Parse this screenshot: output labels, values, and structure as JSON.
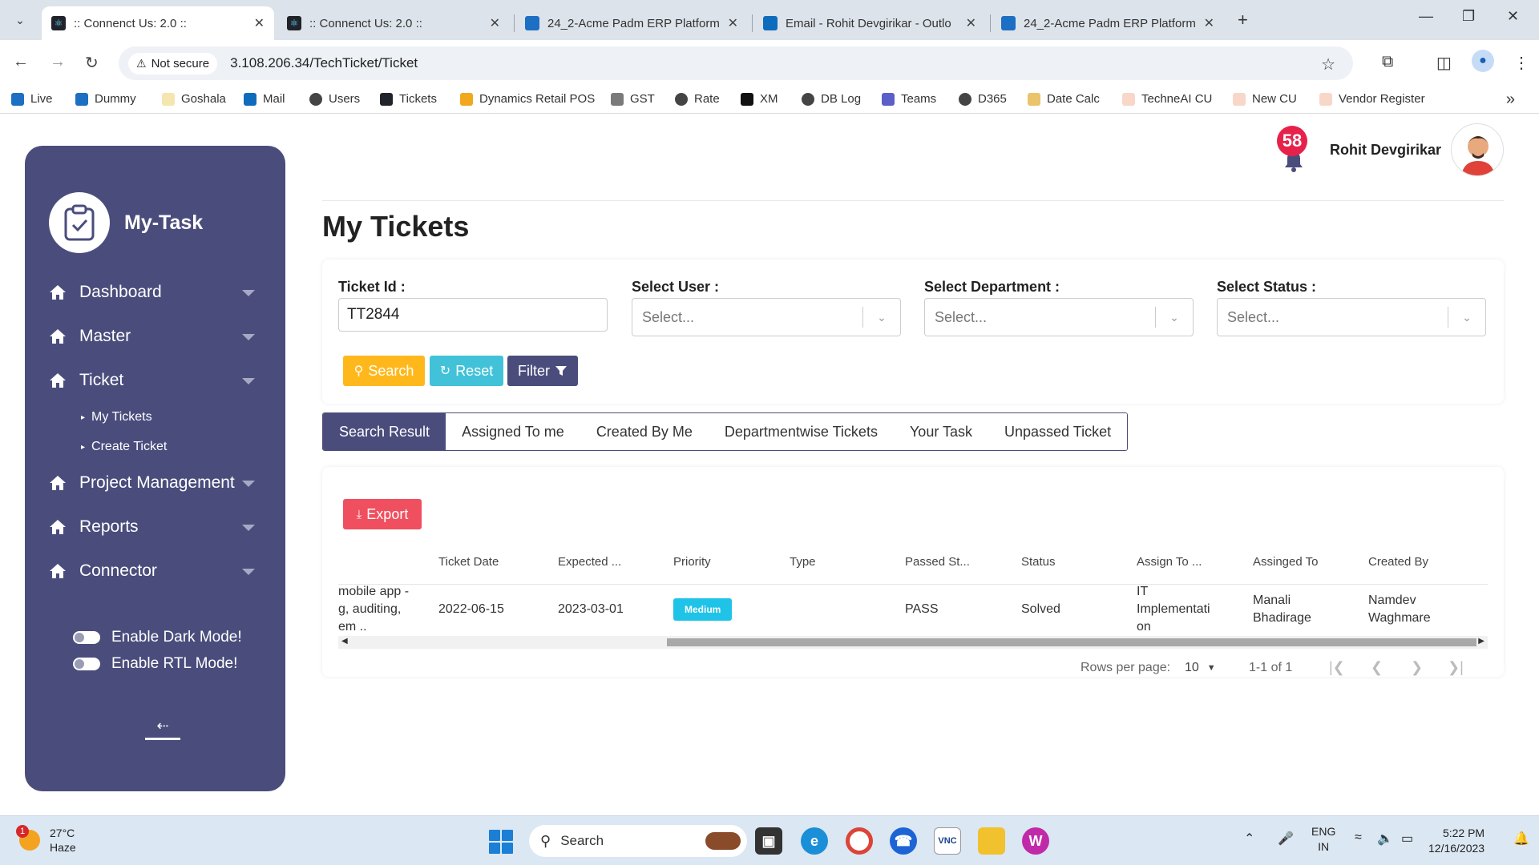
{
  "browser": {
    "tabs": [
      {
        "title": ":: Connenct Us: 2.0 ::",
        "active": true
      },
      {
        "title": ":: Connenct Us: 2.0 ::",
        "active": false
      },
      {
        "title": "24_2-Acme Padm ERP Platform",
        "active": false
      },
      {
        "title": "Email - Rohit Devgirikar - Outlo",
        "active": false
      },
      {
        "title": "24_2-Acme Padm ERP Platform",
        "active": false
      }
    ],
    "security_label": "Not secure",
    "url": "3.108.206.34/TechTicket/Ticket",
    "bookmarks": [
      "Live",
      "Dummy",
      "Goshala",
      "Mail",
      "Users",
      "Tickets",
      "Dynamics Retail POS",
      "GST",
      "Rate",
      "XM",
      "DB Log",
      "Teams",
      "D365",
      "Date Calc",
      "TechneAI CU",
      "New CU",
      "Vendor Register"
    ]
  },
  "sidebar": {
    "brand": "My-Task",
    "items": [
      {
        "label": "Dashboard"
      },
      {
        "label": "Master"
      },
      {
        "label": "Ticket"
      },
      {
        "label": "Project Management"
      },
      {
        "label": "Reports"
      },
      {
        "label": "Connector"
      }
    ],
    "subitems": [
      "My Tickets",
      "Create Ticket"
    ],
    "toggles": [
      "Enable Dark Mode!",
      "Enable RTL Mode!"
    ]
  },
  "header": {
    "notification_count": "58",
    "user_name": "Rohit Devgirikar"
  },
  "page_title": "My Tickets",
  "filters": {
    "ticket_id_label": "Ticket Id :",
    "ticket_id_value": "TT2844",
    "user_label": "Select User :",
    "department_label": "Select Department :",
    "status_label": "Select Status :",
    "select_placeholder": "Select...",
    "search_label": "Search",
    "reset_label": "Reset",
    "filter_label": "Filter"
  },
  "tabs": [
    "Search Result",
    "Assigned To me",
    "Created By Me",
    "Departmentwise Tickets",
    "Your Task",
    "Unpassed Ticket"
  ],
  "results": {
    "export_label": "Export",
    "columns": [
      "Ticket Date",
      "Expected ...",
      "Priority",
      "Type",
      "Passed St...",
      "Status",
      "Assign To ...",
      "Assinged To",
      "Created By"
    ],
    "row": {
      "description": "mobile app -\ng, auditing,\nem ..",
      "ticket_date": "2022-06-15",
      "expected": "2023-03-01",
      "priority": "Medium",
      "type": "",
      "passed_status": "PASS",
      "status": "Solved",
      "assign_to_dept": "IT\nImplementati\non",
      "assigned_to": "Manali\nBhadirage",
      "created_by": "Namdev\nWaghmare"
    },
    "rows_per_page_label": "Rows per page:",
    "rows_per_page_value": "10",
    "range": "1-1 of 1"
  },
  "taskbar": {
    "temperature": "27°C",
    "weather": "Haze",
    "weather_badge": "1",
    "search_label": "Search",
    "lang_top": "ENG",
    "lang_bottom": "IN",
    "time": "5:22 PM",
    "date": "12/16/2023"
  },
  "colors": {
    "sidebar": "#4a4d7c",
    "search_button": "#ffb81c",
    "reset_button": "#42c2d8",
    "filter_button": "#4a4d7c",
    "export_button": "#ef4f5f",
    "badge": "#e8214b",
    "priority_medium": "#1fc3e8"
  }
}
